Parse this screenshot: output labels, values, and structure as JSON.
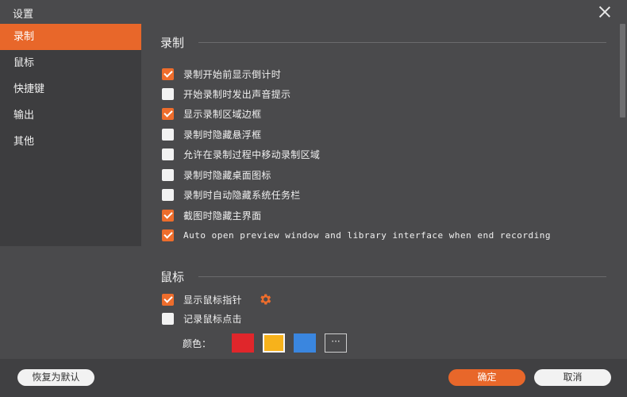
{
  "window": {
    "title": "设置"
  },
  "sidebar": {
    "items": [
      {
        "label": "录制",
        "active": true
      },
      {
        "label": "鼠标"
      },
      {
        "label": "快捷键"
      },
      {
        "label": "输出"
      },
      {
        "label": "其他"
      }
    ]
  },
  "recording": {
    "heading": "录制",
    "options": [
      {
        "label": "录制开始前显示倒计时",
        "checked": true
      },
      {
        "label": "开始录制时发出声音提示",
        "checked": false
      },
      {
        "label": "显示录制区域边框",
        "checked": true
      },
      {
        "label": "录制时隐藏悬浮框",
        "checked": false
      },
      {
        "label": "允许在录制过程中移动录制区域",
        "checked": false
      },
      {
        "label": "录制时隐藏桌面图标",
        "checked": false
      },
      {
        "label": "录制时自动隐藏系统任务栏",
        "checked": false
      },
      {
        "label": "截图时隐藏主界面",
        "checked": true
      },
      {
        "label": "Auto open preview window and library interface when end recording",
        "checked": true
      }
    ]
  },
  "mouse": {
    "heading": "鼠标",
    "options": [
      {
        "label": "显示鼠标指针",
        "checked": true
      },
      {
        "label": "记录鼠标点击",
        "checked": false
      }
    ],
    "color_label": "颜色：",
    "colors": [
      "#e0262b",
      "#f7b21b",
      "#3a86df"
    ],
    "selected_color": "#f7b21b",
    "more_label": "···"
  },
  "footer": {
    "reset_label": "恢复为默认",
    "ok_label": "确定",
    "cancel_label": "取消"
  },
  "theme": {
    "accent": "#e8672a",
    "background": "#4a4a4c",
    "sidebar": "#3d3d3f"
  }
}
